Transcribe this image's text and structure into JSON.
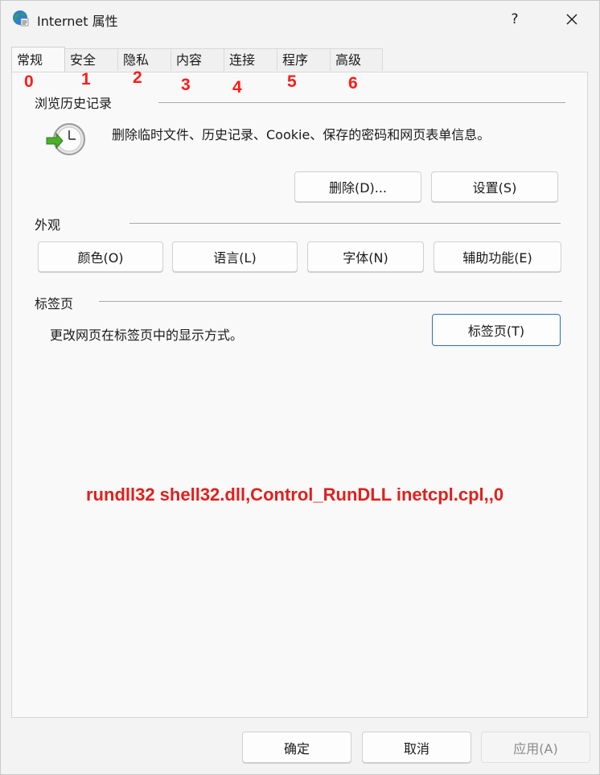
{
  "window": {
    "title": "Internet 属性",
    "help_glyph": "?",
    "close_glyph": "✕"
  },
  "tabs": [
    {
      "label": "常规",
      "number": "0",
      "active": true
    },
    {
      "label": "安全",
      "number": "1"
    },
    {
      "label": "隐私",
      "number": "2"
    },
    {
      "label": "内容",
      "number": "3"
    },
    {
      "label": "连接",
      "number": "4"
    },
    {
      "label": "程序",
      "number": "5"
    },
    {
      "label": "高级",
      "number": "6"
    }
  ],
  "browsing_history": {
    "heading": "浏览历史记录",
    "description": "删除临时文件、历史记录、Cookie、保存的密码和网页表单信息。",
    "icon": "history-clock-icon",
    "delete_button": "删除(D)...",
    "settings_button": "设置(S)"
  },
  "appearance": {
    "heading": "外观",
    "buttons": [
      "颜色(O)",
      "语言(L)",
      "字体(N)",
      "辅助功能(E)"
    ]
  },
  "tabs_section": {
    "heading": "标签页",
    "description": "更改网页在标签页中的显示方式。",
    "button": "标签页(T)"
  },
  "annotation": {
    "command": "rundll32 shell32.dll,Control_RunDLL inetcpl.cpl,,0",
    "color": "#e0201c"
  },
  "footer": {
    "ok": "确定",
    "cancel": "取消",
    "apply": "应用(A)"
  }
}
